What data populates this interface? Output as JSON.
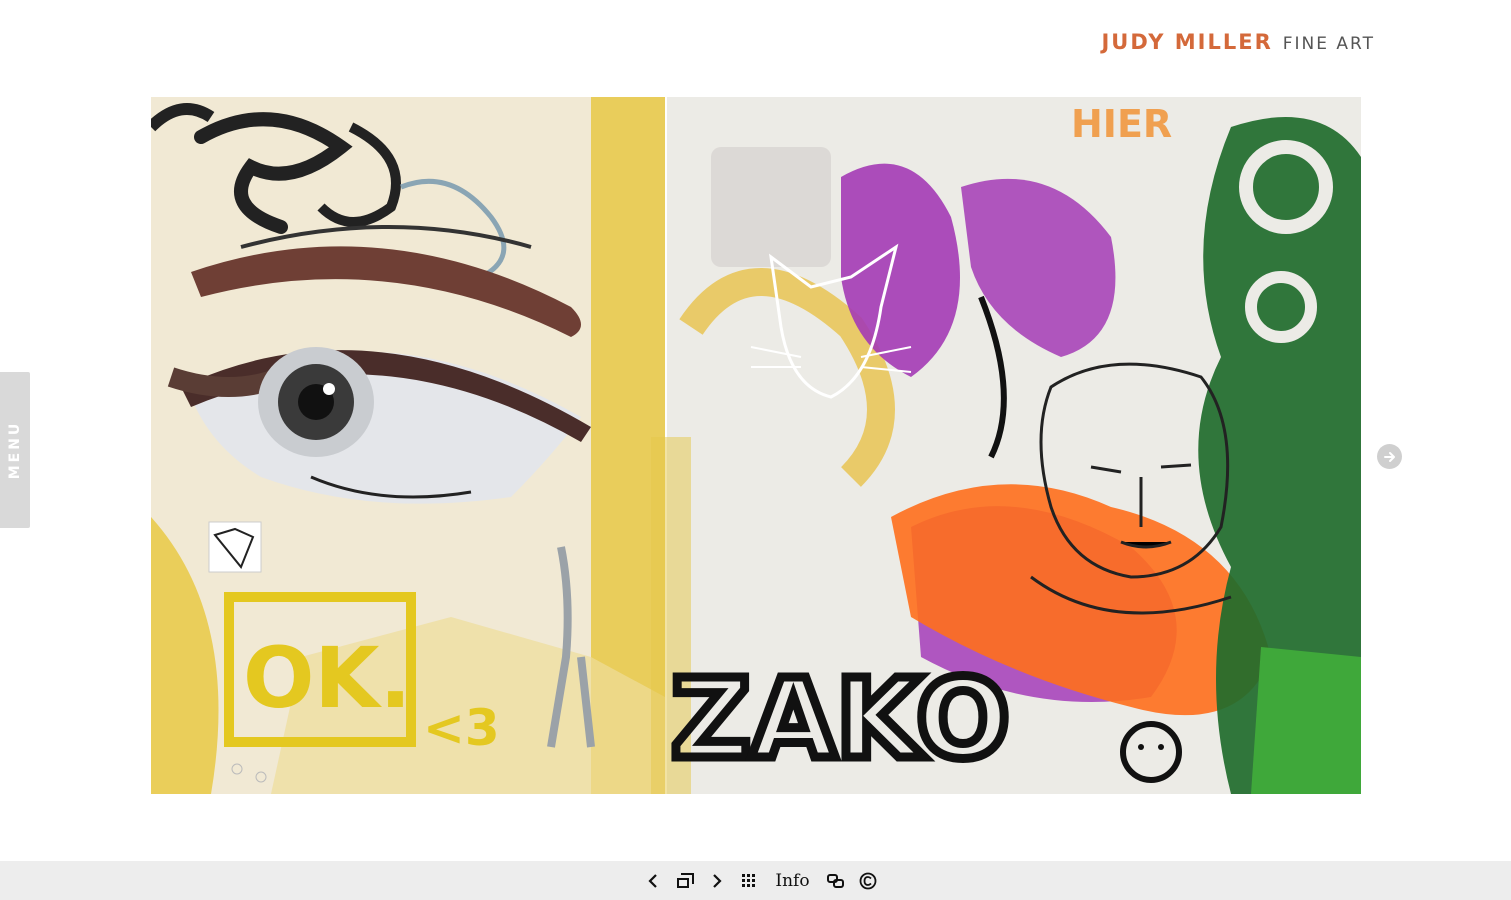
{
  "header": {
    "brand_name": "JUDY MILLER",
    "brand_tagline": "FINE ART"
  },
  "side_menu": {
    "label": "MENU"
  },
  "artwork": {
    "painted_texts": [
      "OK.",
      "<3",
      "ZAKO",
      "HIER"
    ]
  },
  "bottom_nav": {
    "info_label": "Info",
    "icons": [
      "chevron-left-icon",
      "slideshow-icon",
      "chevron-right-icon",
      "grid-icon",
      "share-icon",
      "copyright-icon"
    ]
  },
  "colors": {
    "brand_accent": "#d4693a",
    "menu_tab_bg": "#d9d9d9",
    "bottom_bar_bg": "#ededed"
  }
}
